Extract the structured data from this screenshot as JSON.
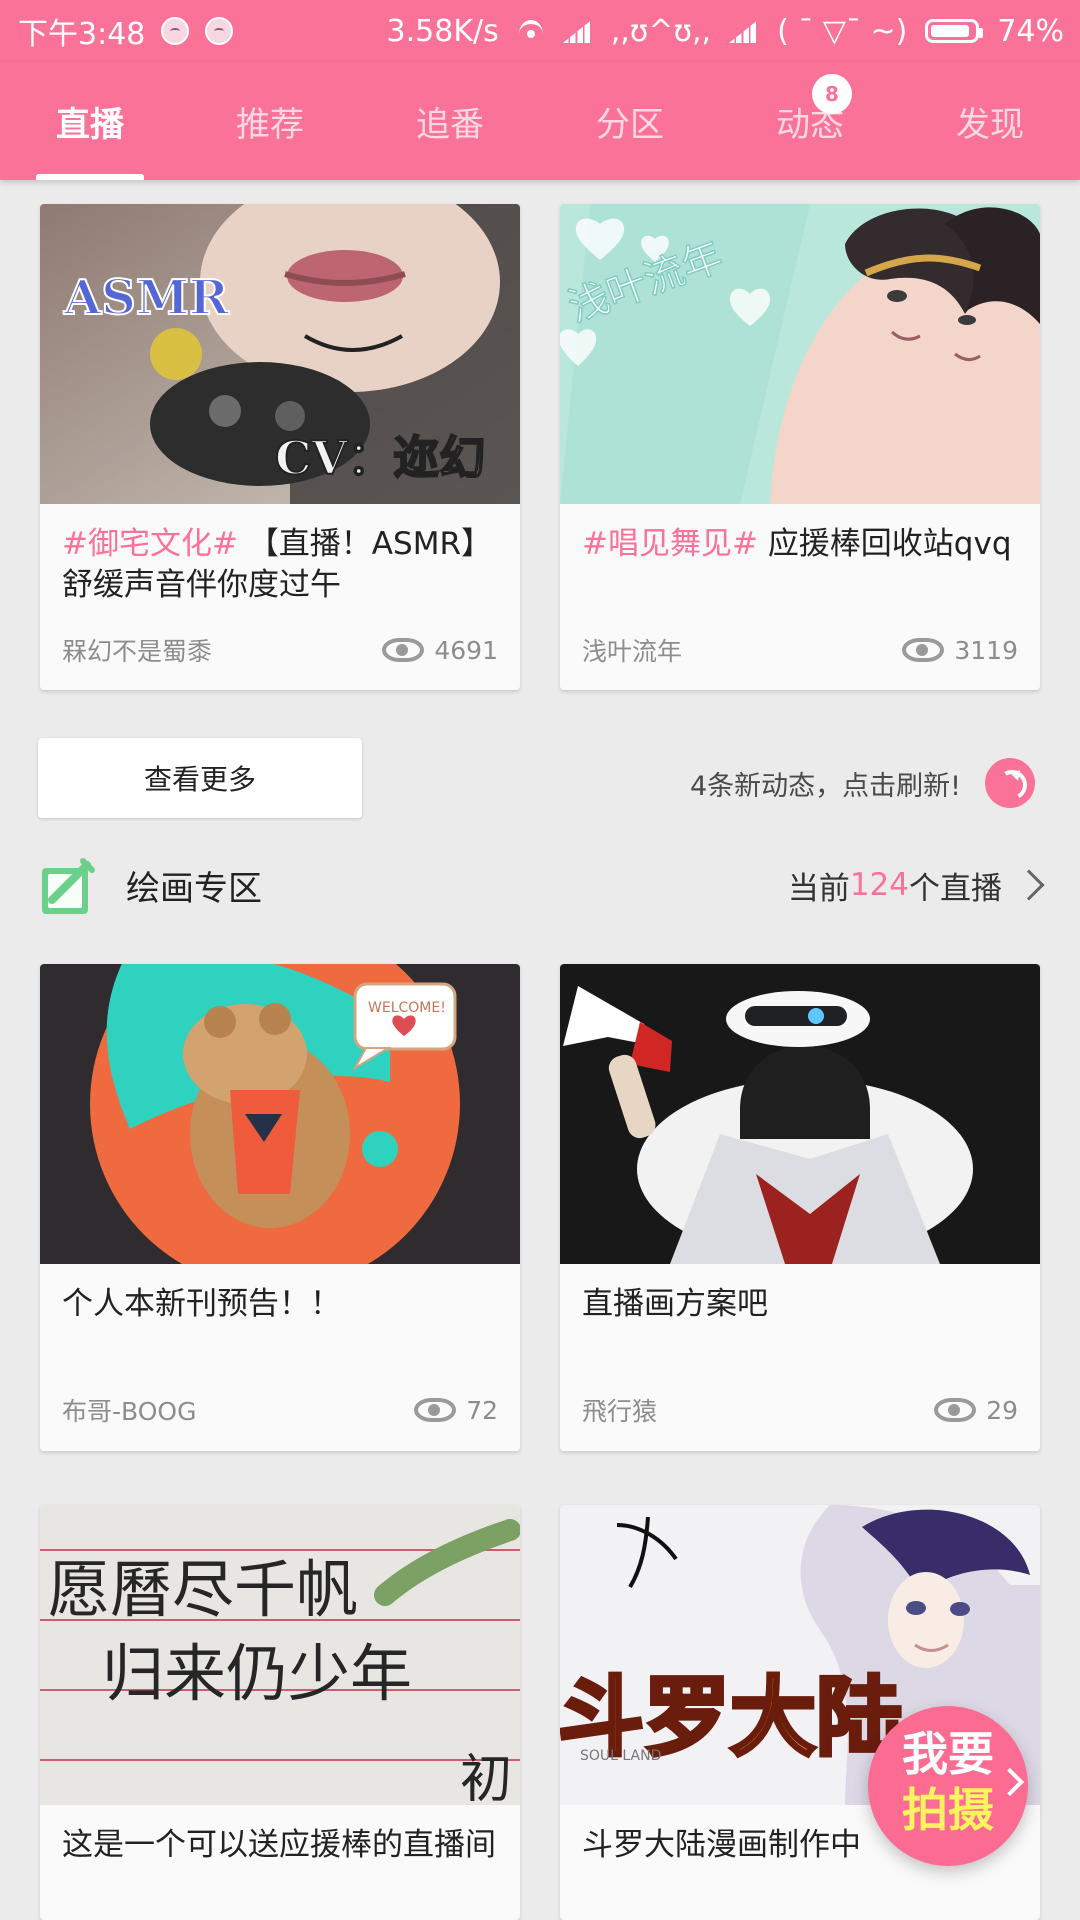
{
  "status_bar": {
    "time": "下午3:48",
    "network_speed": "3.58K/s",
    "emoticon_1": ",,ʊ^ʊ,,",
    "emoticon_2": "( ˉ ▽ˉ ~)",
    "battery": "74%"
  },
  "tabs": [
    {
      "label": "直播",
      "active": true
    },
    {
      "label": "推荐",
      "active": false
    },
    {
      "label": "追番",
      "active": false
    },
    {
      "label": "分区",
      "active": false
    },
    {
      "label": "动态",
      "active": false,
      "badge": "8"
    },
    {
      "label": "发现",
      "active": false
    }
  ],
  "top_cards": [
    {
      "tag": "#御宅文化#",
      "title": "【直播！ASMR】舒缓声音伴你度过午",
      "author": "槑幻不是蜀黍",
      "views": "4691",
      "thumb_text_1": "ASMR",
      "thumb_text_2": "CV：迩幻"
    },
    {
      "tag": "#唱见舞见#",
      "title": " 应援棒回收站qvq",
      "author": "浅叶流年",
      "views": "3119",
      "thumb_text_1": "浅叶流年"
    }
  ],
  "actions": {
    "more_label": "查看更多",
    "refresh_text": "4条新动态，点击刷新!"
  },
  "section": {
    "title": "绘画专区",
    "live_prefix": "当前",
    "live_count": "124",
    "live_suffix": "个直播"
  },
  "painting_cards": [
    {
      "title": "个人本新刊预告！！",
      "author": "布哥-BOOG",
      "views": "72",
      "thumb_text": "WELCOME!"
    },
    {
      "title": "直播画方案吧",
      "author": "飛行猿",
      "views": "29"
    },
    {
      "title": "这是一个可以送应援棒的直播间",
      "author": "",
      "views": "",
      "thumb_lines": [
        "愿曆尽千帆",
        "归来仍少年",
        "初"
      ]
    },
    {
      "title": "斗罗大陆漫画制作中",
      "author": "",
      "views": "",
      "thumb_text": "斗罗大陆",
      "thumb_small": "SOUL LAND"
    }
  ],
  "floating_button": {
    "line1": "我要",
    "line2": "拍摄"
  },
  "colors": {
    "brand": "#fb7299",
    "background": "#ebebeb",
    "card": "#fafafa",
    "accent_yellow": "#fff45f"
  },
  "icons": {
    "section": "canvas-edit-icon",
    "view": "eye-icon",
    "refresh": "refresh-icon",
    "arrow": "chevron-right-icon"
  }
}
